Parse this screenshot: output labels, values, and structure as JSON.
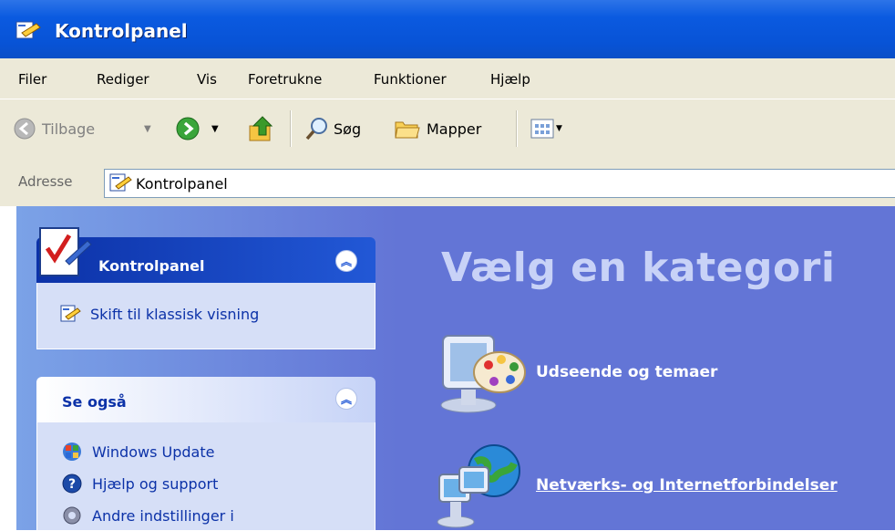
{
  "window": {
    "title": "Kontrolpanel"
  },
  "menu": {
    "items": [
      "Filer",
      "Rediger",
      "Vis",
      "Foretrukne",
      "Funktioner",
      "Hjælp"
    ]
  },
  "toolbar": {
    "back_label": "Tilbage",
    "search_label": "Søg",
    "folders_label": "Mapper"
  },
  "address": {
    "label": "Adresse",
    "value": "Kontrolpanel"
  },
  "sidebar": {
    "control_panel": {
      "title": "Kontrolpanel",
      "switch_link": "Skift til klassisk visning"
    },
    "see_also": {
      "title": "Se også",
      "links": [
        "Windows Update",
        "Hjælp og support",
        "Andre indstillinger i"
      ]
    }
  },
  "main": {
    "heading": "Vælg en kategori",
    "categories": [
      "Udseende og temaer",
      "Netværks- og Internetforbindelser"
    ]
  },
  "colors": {
    "title_bar": "#0853d6",
    "pane_background": "#6375d6",
    "link": "#0c32a8"
  }
}
